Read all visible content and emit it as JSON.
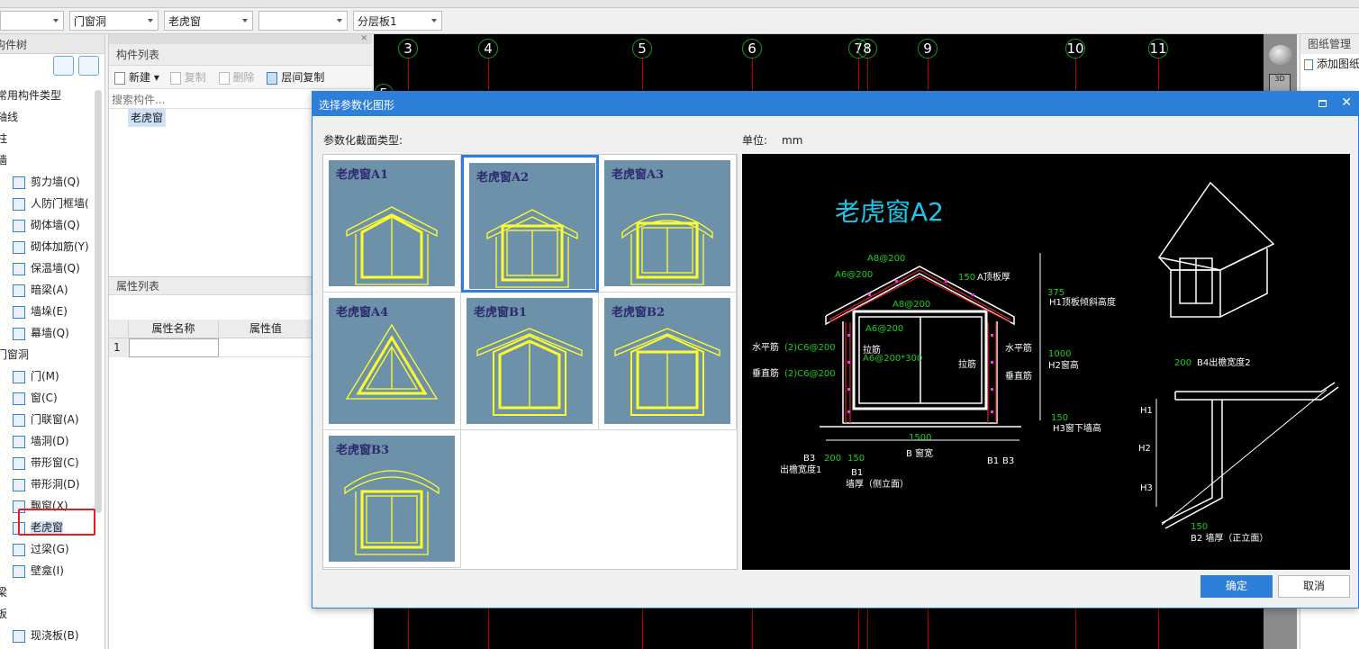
{
  "toolbar": {
    "dropdowns": [
      "",
      "门窗洞",
      "老虎窗",
      "",
      "分层板1"
    ]
  },
  "left": {
    "title": "构件树",
    "tree": [
      {
        "label": "常用构件类型",
        "level": 0
      },
      {
        "label": "轴线",
        "level": 0
      },
      {
        "label": "柱",
        "level": 0
      },
      {
        "label": "墙",
        "level": 0
      },
      {
        "label": "剪力墙(Q)",
        "level": 1
      },
      {
        "label": "人防门框墙(",
        "level": 1
      },
      {
        "label": "砌体墙(Q)",
        "level": 1
      },
      {
        "label": "砌体加筋(Y)",
        "level": 1
      },
      {
        "label": "保温墙(Q)",
        "level": 1
      },
      {
        "label": "暗梁(A)",
        "level": 1
      },
      {
        "label": "墙垛(E)",
        "level": 1
      },
      {
        "label": "幕墙(Q)",
        "level": 1
      },
      {
        "label": "门窗洞",
        "level": 0
      },
      {
        "label": "门(M)",
        "level": 1
      },
      {
        "label": "窗(C)",
        "level": 1
      },
      {
        "label": "门联窗(A)",
        "level": 1
      },
      {
        "label": "墙洞(D)",
        "level": 1
      },
      {
        "label": "带形窗(C)",
        "level": 1
      },
      {
        "label": "带形洞(D)",
        "level": 1
      },
      {
        "label": "飘窗(X)",
        "level": 1
      },
      {
        "label": "老虎窗",
        "level": 1,
        "selected": true
      },
      {
        "label": "过梁(G)",
        "level": 1
      },
      {
        "label": "壁龛(I)",
        "level": 1
      },
      {
        "label": "梁",
        "level": 0
      },
      {
        "label": "板",
        "level": 0
      },
      {
        "label": "现浇板(B)",
        "level": 1
      }
    ]
  },
  "components": {
    "title": "构件列表",
    "new": "新建",
    "copy": "复制",
    "delete": "删除",
    "floor_copy": "层间复制",
    "search_placeholder": "搜索构件...",
    "items": [
      "老虎窗"
    ]
  },
  "properties": {
    "title": "属性列表",
    "col_name": "属性名称",
    "col_value": "属性值",
    "row_index": "1"
  },
  "cad": {
    "axes": [
      "3",
      "4",
      "5",
      "6",
      "7",
      "8",
      "9",
      "10",
      "11"
    ],
    "partial_axis": "5"
  },
  "right_panel": {
    "title": "图纸管理",
    "add": "添加图纸"
  },
  "dialog": {
    "title": "选择参数化图形",
    "type_label": "参数化截面类型:",
    "unit_label": "单位:",
    "unit": "mm",
    "shapes": [
      "老虎窗A1",
      "老虎窗A2",
      "老虎窗A3",
      "老虎窗A4",
      "老虎窗B1",
      "老虎窗B2",
      "老虎窗B3"
    ],
    "selected": "老虎窗A2",
    "ok": "确定",
    "cancel": "取消"
  },
  "preview": {
    "title": "老虎窗A2",
    "labels": {
      "a8_top": "A8@200",
      "a6_top": "A6@200",
      "roof_thk_val": "150",
      "roof_thk": "A顶板厚",
      "a8_mid": "A8@200",
      "a6_mid": "A6@200",
      "h1_val": "375",
      "h1": "H1顶板倾斜高度",
      "hbar": "水平筋",
      "hbar_val": "(2)C6@200",
      "tie": "拉筋",
      "tie_val": "A6@200*300",
      "hbar_r": "水平筋",
      "tie_r": "拉筋",
      "h2_val": "1000",
      "h2": "H2窗高",
      "vbar": "垂直筋",
      "vbar_val": "(2)C6@200",
      "vbar_r": "垂直筋",
      "h3_val": "150",
      "h3": "H3窗下墙高",
      "b_val": "1500",
      "b": "B 窗宽",
      "b3": "B3",
      "b3_val": "200",
      "b1_val": "150",
      "b3_desc": "出檐宽度1",
      "b1": "B1",
      "b1_desc": "墙厚（侧立面）",
      "b1_r": "B1",
      "b3_r": "B3",
      "b4_val": "200",
      "b4": "B4出檐宽度2",
      "sh1": "H1",
      "sh2": "H2",
      "sh3": "H3",
      "b2_val": "150",
      "b2": "B2 墙厚（正立面）"
    }
  }
}
